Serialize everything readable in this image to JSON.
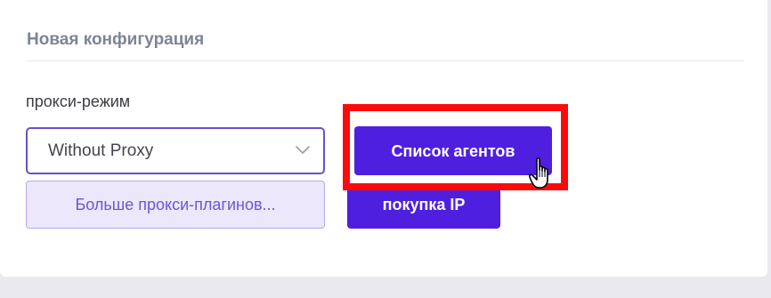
{
  "config": {
    "title": "Новая конфигурация",
    "proxy_mode_label": "прокси-режим",
    "proxy_select": {
      "value": "Without Proxy",
      "icon": "chevron-down-icon"
    },
    "more_plugins_label": "Больше прокси-плагинов...",
    "agents_list_label": "Список агентов",
    "buy_ip_label": "покупка IP"
  },
  "colors": {
    "primary": "#4f1fe0",
    "select_border": "#6a4fd1",
    "secondary_bg": "#ece7fb",
    "secondary_text": "#6e55d3",
    "highlight": "#ff0a0a",
    "title_text": "#7d8494"
  },
  "cursor": {
    "icon": "hand-pointer-icon"
  }
}
